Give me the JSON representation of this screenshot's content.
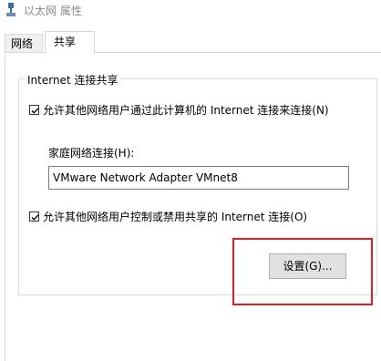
{
  "window": {
    "title": "以太网 属性",
    "icon": "network-adapter-icon"
  },
  "tabs": [
    {
      "label": "网络",
      "active": false
    },
    {
      "label": "共享",
      "active": true
    }
  ],
  "sharing": {
    "group_title": "Internet 连接共享",
    "allow_connect": {
      "label": "允许其他网络用户通过此计算机的 Internet 连接来连接(N)",
      "checked": true
    },
    "home_network": {
      "label": "家庭网络连接(H):",
      "value": "VMware Network Adapter VMnet8"
    },
    "allow_control": {
      "label": "允许其他网络用户控制或禁用共享的 Internet 连接(O)",
      "checked": true
    },
    "settings_button": "设置(G)..."
  },
  "colors": {
    "highlight": "#e02020",
    "button_bg": "#e1e1e1",
    "border": "#d9d9d9"
  }
}
